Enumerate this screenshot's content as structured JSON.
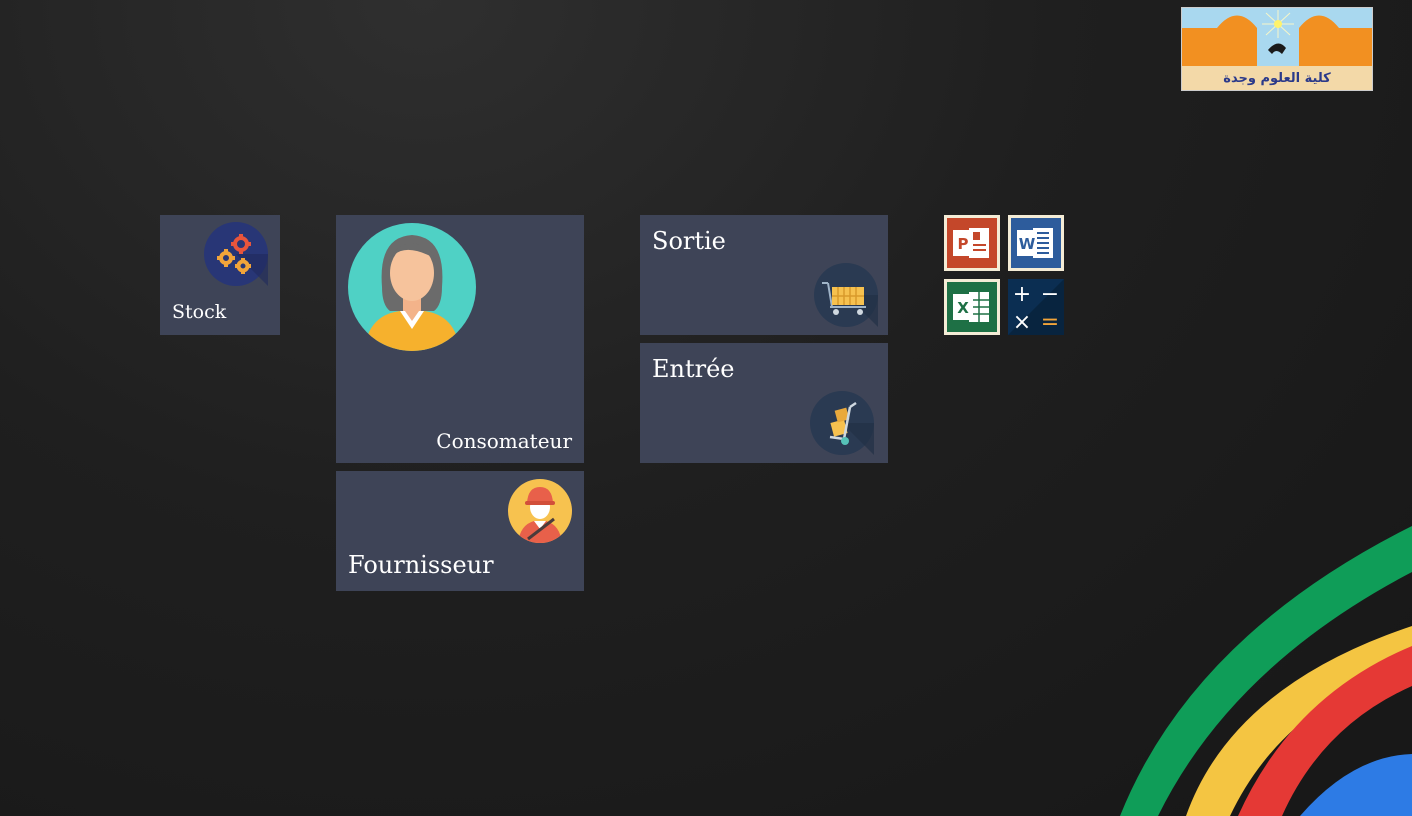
{
  "tiles": {
    "stock": {
      "label": "Stock",
      "icon": "gears-icon"
    },
    "consomateur": {
      "label": "Consomateur",
      "icon": "user-woman-icon"
    },
    "fournisseur": {
      "label": "Fournisseur",
      "icon": "worker-icon"
    },
    "sortie": {
      "label": "Sortie",
      "icon": "cart-icon"
    },
    "entree": {
      "label": "Entrée",
      "icon": "hand-truck-icon"
    }
  },
  "apps": [
    {
      "name": "powerpoint",
      "letter": "P",
      "color": "#c4472a"
    },
    {
      "name": "word",
      "letter": "W",
      "color": "#2d5c9c"
    },
    {
      "name": "excel",
      "letter": "X",
      "color": "#1e7045"
    },
    {
      "name": "calculator",
      "symbols": [
        "+",
        "−",
        "×",
        "="
      ],
      "color": "#0b2e52"
    }
  ],
  "logo": {
    "text": "كلية العلوم وجدة"
  },
  "colors": {
    "tile": "#3e4457",
    "background": "#1f1f1f",
    "green": "#0f9d58",
    "yellow": "#f4c542",
    "red": "#e53935",
    "blue": "#2d7be5"
  }
}
